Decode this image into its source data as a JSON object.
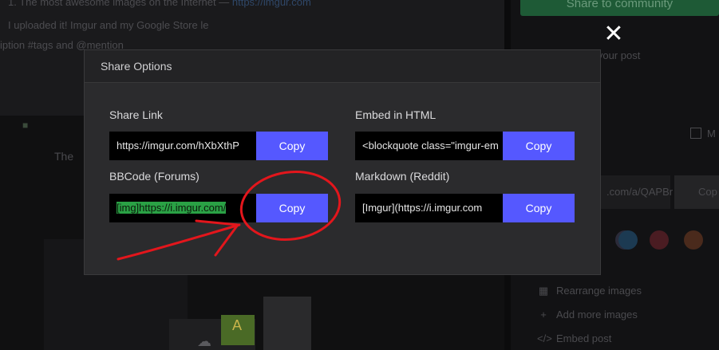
{
  "background": {
    "line1_prefix": "1. The most awesome images on the Internet —",
    "line1_link": "https://imgur.com",
    "line2_prefix": "I uploaded it! Imgur and my Google Store le",
    "line3_prefix": "iption #tags and @mention",
    "the_text": "The",
    "right": {
      "share_to_community": "Share to community",
      "add_post_text": "d your post",
      "checkbox_label": "M",
      "url_fragment": ".com/a/QAPBr",
      "copy_fragment": "Cop",
      "menu_items": [
        "Rearrange images",
        "Add more images",
        "Embed post"
      ]
    }
  },
  "modal": {
    "title": "Share Options",
    "share_link": {
      "label": "Share Link",
      "value": "https://imgur.com/hXbXthP",
      "copy": "Copy"
    },
    "embed_html": {
      "label": "Embed in HTML",
      "value": "<blockquote class=\"imgur-em",
      "copy": "Copy"
    },
    "bbcode": {
      "label": "BBCode (Forums)",
      "value_selected": "[img]https://i.imgur.com/",
      "copy": "Copy"
    },
    "markdown": {
      "label": "Markdown (Reddit)",
      "value": "[Imgur](https://i.imgur.com",
      "copy": "Copy"
    }
  },
  "colors": {
    "copy_button": "#5558ff",
    "annotation": "#e3161c",
    "selection": "#2aa145"
  },
  "icons": [
    "close-icon",
    "upload-icon",
    "rearrange-icon",
    "plus-icon",
    "code-icon"
  ]
}
